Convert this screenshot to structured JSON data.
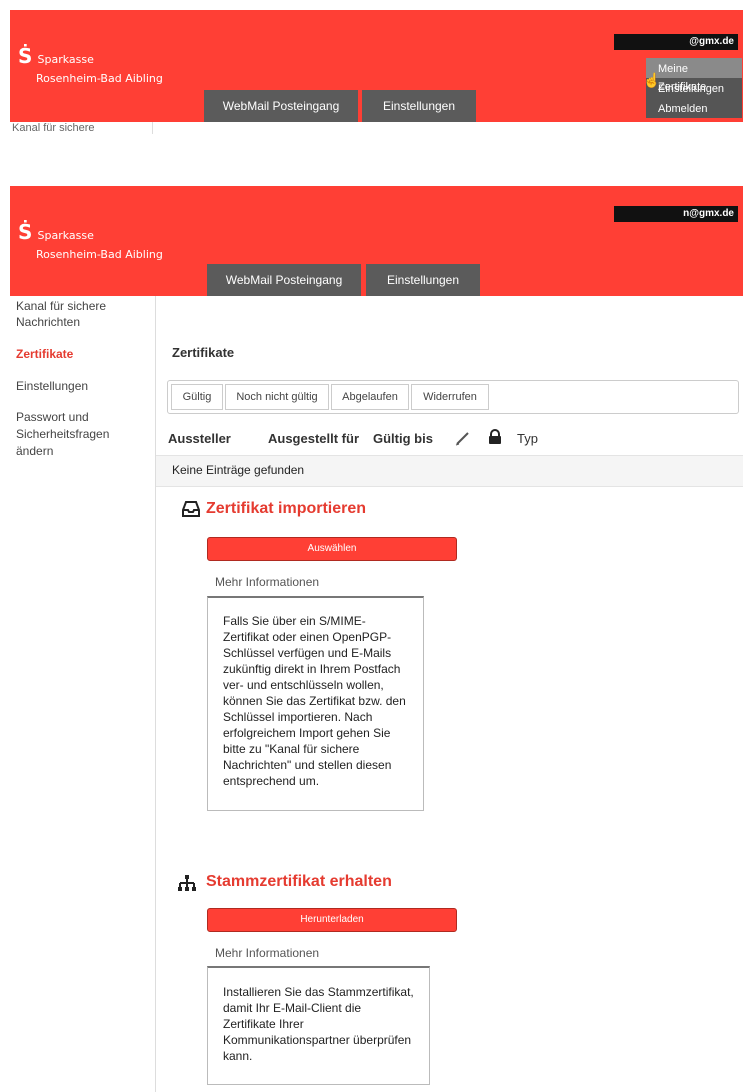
{
  "top_screenshot": {
    "logo": {
      "line1": "Sparkasse",
      "line2": "Rosenheim-Bad Aibling"
    },
    "user_email": "@gmx.de",
    "tabs": [
      "WebMail Posteingang",
      "Einstellungen"
    ],
    "user_menu": [
      "Meine Zertifikate",
      "Einstellungen",
      "Abmelden"
    ],
    "sidebar_partial": "Kanal für sichere"
  },
  "main": {
    "logo": {
      "line1": "Sparkasse",
      "line2": "Rosenheim-Bad Aibling"
    },
    "user_email": "n@gmx.de",
    "tabs": [
      "WebMail Posteingang",
      "Einstellungen"
    ],
    "sidebar": {
      "items": [
        {
          "label": "Kanal für sichere Nachrichten"
        },
        {
          "label": "Zertifikate"
        },
        {
          "label": "Einstellungen"
        },
        {
          "label": "Passwort und Sicherheitsfragen ändern"
        }
      ]
    },
    "page_title": "Zertifikate",
    "filters": [
      "Gültig",
      "Noch nicht gültig",
      "Abgelaufen",
      "Widerrufen"
    ],
    "columns": [
      "Aussteller",
      "Ausgestellt für",
      "Gültig bis",
      "Typ"
    ],
    "empty_text": "Keine Einträge gefunden",
    "import": {
      "title": "Zertifikat importieren",
      "button": "Auswählen",
      "more": "Mehr Informationen",
      "text": "Falls Sie über ein S/MIME-Zertifikat oder einen OpenPGP-Schlüssel verfügen und E-Mails zukünftig direkt in Ihrem Postfach ver- und entschlüsseln wollen, können Sie das Zertifikat bzw. den Schlüssel importieren. Nach erfolgreichem Import gehen Sie bitte zu \"Kanal für sichere Nachrichten\" und stellen diesen entsprechend um."
    },
    "root": {
      "title": "Stammzertifikat erhalten",
      "button": "Herunterladen",
      "more": "Mehr Informationen",
      "text": "Installieren Sie das Stammzertifikat, damit Ihr E-Mail-Client die Zertifikate Ihrer Kommunikationspartner überprüfen kann."
    }
  },
  "colors": {
    "brand_red": "#ff3f35",
    "accent_red": "#e53b30",
    "tab_gray": "#5b5b5b"
  }
}
